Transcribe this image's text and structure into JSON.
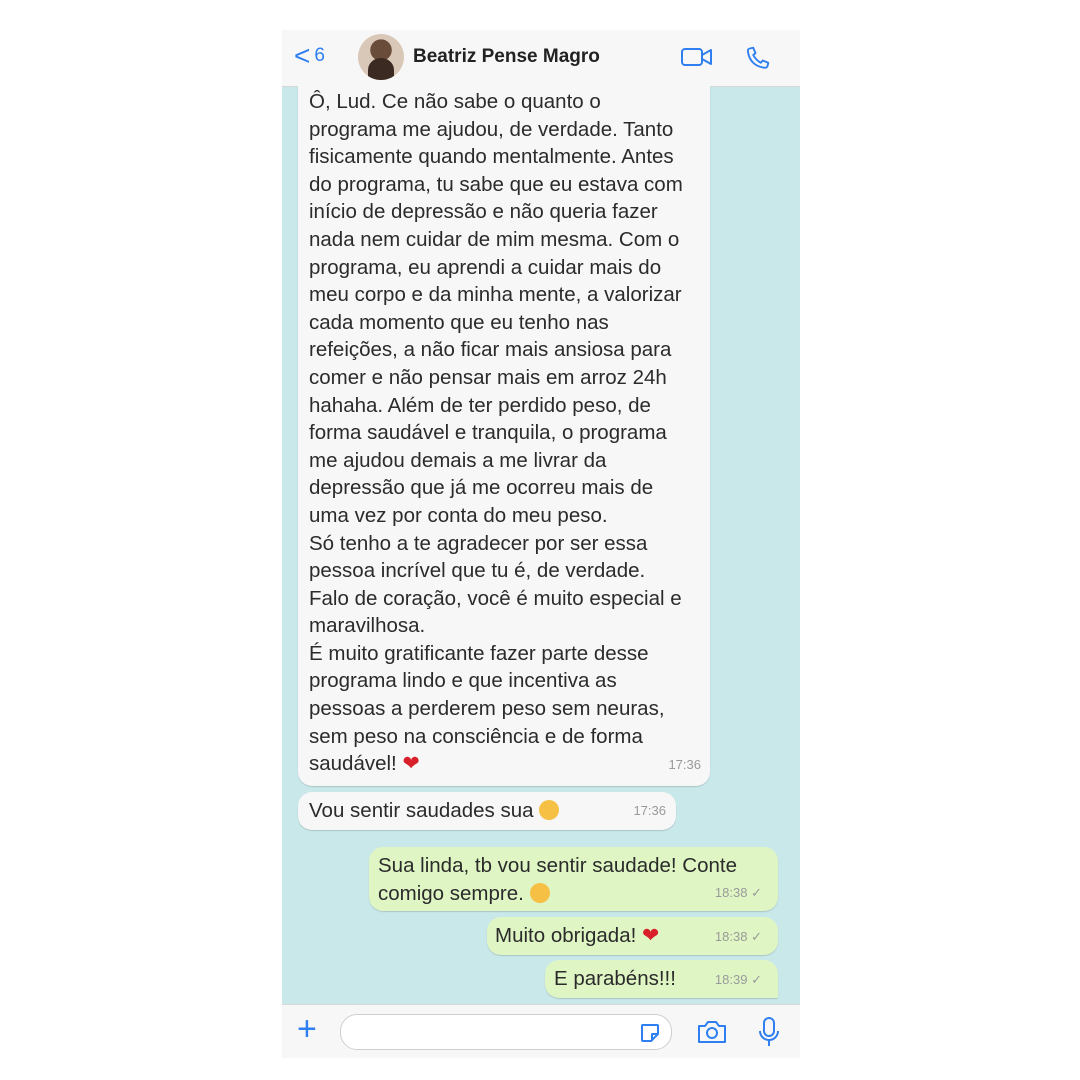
{
  "header": {
    "back_label": "<",
    "back_count": "6",
    "contact_name": "Beatriz Pense Magro",
    "icons": [
      "video-call-icon",
      "phone-call-icon"
    ]
  },
  "messages": [
    {
      "direction": "incoming",
      "text": "Ô, Lud. Ce não sabe o quanto o\nprograma me ajudou, de verdade. Tanto\nfisicamente quando mentalmente. Antes\ndo programa, tu sabe que eu estava com\ninício de depressão e não queria fazer\nnada nem cuidar de mim mesma. Com o\nprograma, eu aprendi a cuidar mais do\nmeu corpo e da minha mente, a valorizar\ncada momento que eu tenho nas\nrefeições, a não ficar mais ansiosa para\ncomer e não pensar mais em arroz 24h\nhahaha. Além de ter perdido peso, de\nforma saudável e tranquila, o programa\nme ajudou demais a me livrar da\ndepressão que já me ocorreu mais de\numa vez por conta do meu peso.\nSó tenho a te agradecer por ser essa\npessoa incrível que tu é, de verdade.\nFalo de coração, você é muito especial e\nmaravilhosa.\nÉ muito gratificante fazer parte desse\nprograma lindo e que incentiva as\npessoas a perderem peso sem neuras,\nsem peso na consciência e de forma\nsaudável!",
      "time": "17:36",
      "emoji": "red-heart"
    },
    {
      "direction": "incoming",
      "text": "Vou sentir saudades sua",
      "time": "17:36",
      "emoji": "crying-face"
    },
    {
      "direction": "outgoing",
      "text": "Sua linda, tb vou sentir saudade! Conte\ncomigo sempre.",
      "time": "18:38",
      "emoji": "kissing-face"
    },
    {
      "direction": "outgoing",
      "text": "Muito obrigada!",
      "time": "18:38",
      "emoji": "red-heart"
    },
    {
      "direction": "outgoing",
      "text": "E parabéns!!!",
      "time": "18:39"
    }
  ],
  "checkmark": "✓",
  "footer": {
    "plus_label": "+",
    "input_value": "",
    "icons": [
      "sticker-icon",
      "camera-icon",
      "microphone-icon"
    ]
  },
  "colors": {
    "accent": "#2f7ff0",
    "chat_background": "#c9e8ea",
    "incoming_bubble": "#f7f7f7",
    "outgoing_bubble": "#dff6c4",
    "heart": "#d81f2a"
  }
}
